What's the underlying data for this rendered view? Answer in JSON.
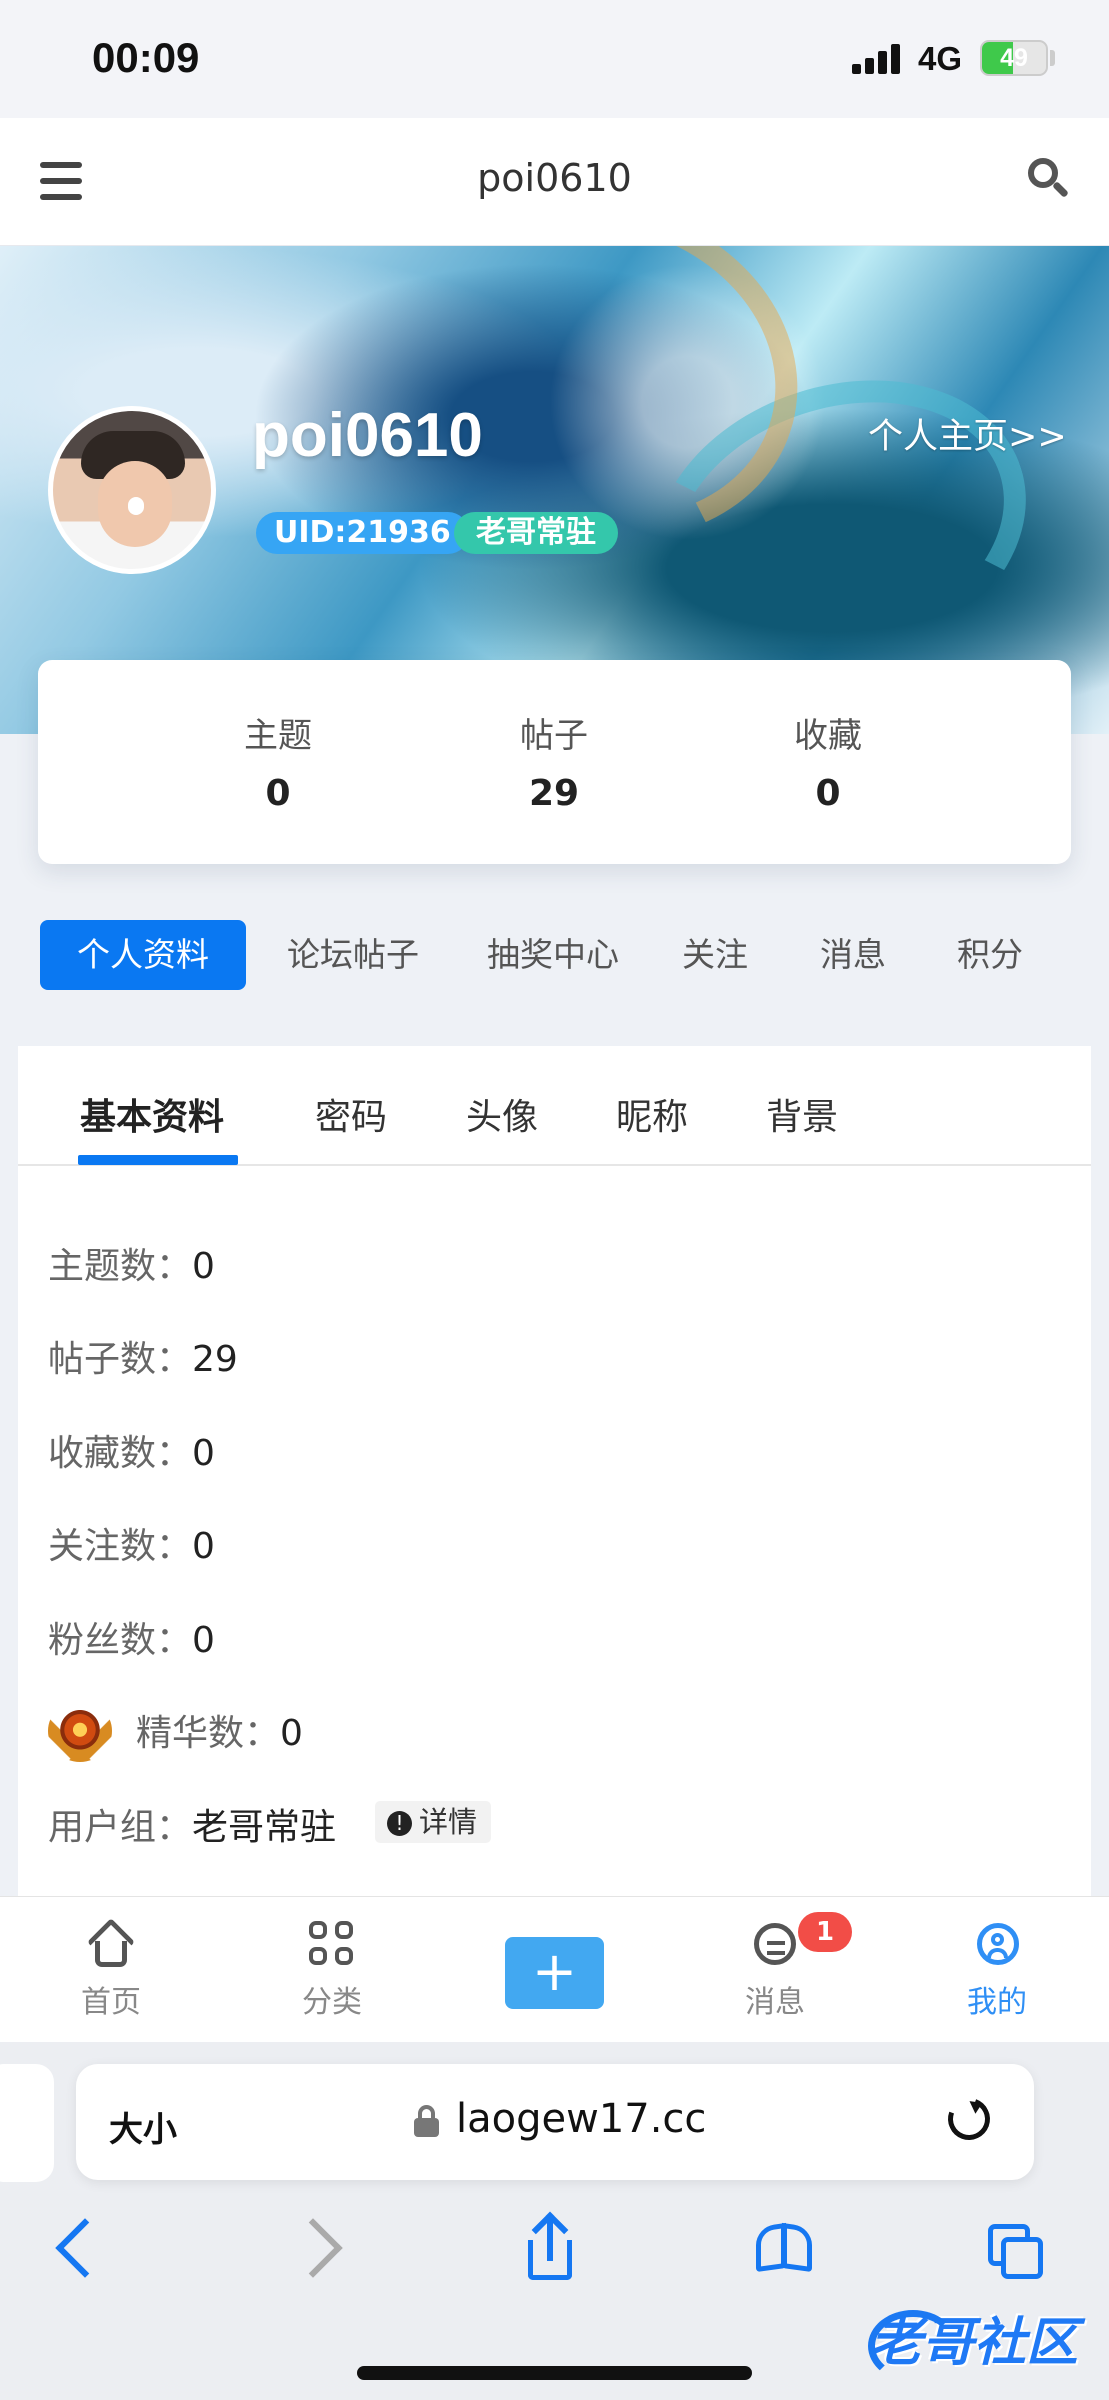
{
  "status_bar": {
    "time": "00:09",
    "network": "4G",
    "battery": "49",
    "battery_level_percent": 49
  },
  "top_nav": {
    "title": "poi0610"
  },
  "profile": {
    "username": "poi0610",
    "home_link": "个人主页>>",
    "uid": "UID:21936",
    "group_badge": "老哥常驻"
  },
  "stats": [
    {
      "label": "主题",
      "value": "0"
    },
    {
      "label": "帖子",
      "value": "29"
    },
    {
      "label": "收藏",
      "value": "0"
    }
  ],
  "main_tabs": [
    {
      "label": "个人资料"
    },
    {
      "label": "论坛帖子"
    },
    {
      "label": "抽奖中心"
    },
    {
      "label": "关注"
    },
    {
      "label": "消息"
    },
    {
      "label": "积分"
    }
  ],
  "sub_tabs": [
    {
      "label": "基本资料"
    },
    {
      "label": "密码"
    },
    {
      "label": "头像"
    },
    {
      "label": "昵称"
    },
    {
      "label": "背景"
    }
  ],
  "info": [
    {
      "label": "主题数：",
      "value": "0"
    },
    {
      "label": "帖子数：",
      "value": "29"
    },
    {
      "label": "收藏数：",
      "value": "0"
    },
    {
      "label": "关注数：",
      "value": "0"
    },
    {
      "label": "粉丝数：",
      "value": "0"
    },
    {
      "label": "精华数：",
      "value": "0"
    },
    {
      "label": "用户组：",
      "value": "老哥常驻",
      "detail": "详情"
    }
  ],
  "bottom_nav": {
    "home": "首页",
    "category": "分类",
    "add_symbol": "+",
    "messages": "消息",
    "messages_badge": "1",
    "profile": "我的"
  },
  "browser": {
    "text_size": "大小",
    "url": "laogew17.cc"
  },
  "watermark": "老哥社区",
  "colors": {
    "accent": "#0a78f2",
    "uid_badge": "#36a5f4",
    "group_badge": "#34c7ab",
    "notification": "#f24d47"
  }
}
